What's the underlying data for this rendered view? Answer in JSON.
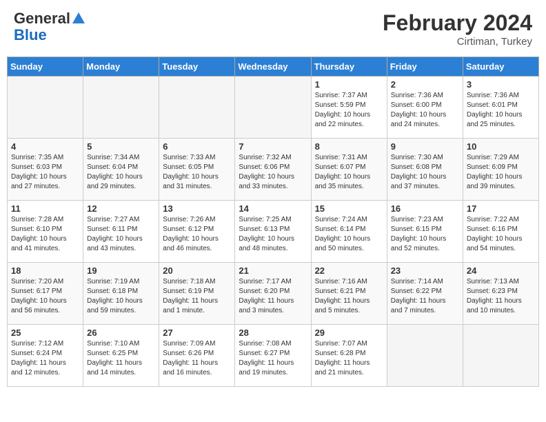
{
  "header": {
    "logo_general": "General",
    "logo_blue": "Blue",
    "month_title": "February 2024",
    "subtitle": "Cirtiman, Turkey"
  },
  "days_of_week": [
    "Sunday",
    "Monday",
    "Tuesday",
    "Wednesday",
    "Thursday",
    "Friday",
    "Saturday"
  ],
  "weeks": [
    [
      {
        "num": "",
        "info": ""
      },
      {
        "num": "",
        "info": ""
      },
      {
        "num": "",
        "info": ""
      },
      {
        "num": "",
        "info": ""
      },
      {
        "num": "1",
        "info": "Sunrise: 7:37 AM\nSunset: 5:59 PM\nDaylight: 10 hours and 22 minutes."
      },
      {
        "num": "2",
        "info": "Sunrise: 7:36 AM\nSunset: 6:00 PM\nDaylight: 10 hours and 24 minutes."
      },
      {
        "num": "3",
        "info": "Sunrise: 7:36 AM\nSunset: 6:01 PM\nDaylight: 10 hours and 25 minutes."
      }
    ],
    [
      {
        "num": "4",
        "info": "Sunrise: 7:35 AM\nSunset: 6:03 PM\nDaylight: 10 hours and 27 minutes."
      },
      {
        "num": "5",
        "info": "Sunrise: 7:34 AM\nSunset: 6:04 PM\nDaylight: 10 hours and 29 minutes."
      },
      {
        "num": "6",
        "info": "Sunrise: 7:33 AM\nSunset: 6:05 PM\nDaylight: 10 hours and 31 minutes."
      },
      {
        "num": "7",
        "info": "Sunrise: 7:32 AM\nSunset: 6:06 PM\nDaylight: 10 hours and 33 minutes."
      },
      {
        "num": "8",
        "info": "Sunrise: 7:31 AM\nSunset: 6:07 PM\nDaylight: 10 hours and 35 minutes."
      },
      {
        "num": "9",
        "info": "Sunrise: 7:30 AM\nSunset: 6:08 PM\nDaylight: 10 hours and 37 minutes."
      },
      {
        "num": "10",
        "info": "Sunrise: 7:29 AM\nSunset: 6:09 PM\nDaylight: 10 hours and 39 minutes."
      }
    ],
    [
      {
        "num": "11",
        "info": "Sunrise: 7:28 AM\nSunset: 6:10 PM\nDaylight: 10 hours and 41 minutes."
      },
      {
        "num": "12",
        "info": "Sunrise: 7:27 AM\nSunset: 6:11 PM\nDaylight: 10 hours and 43 minutes."
      },
      {
        "num": "13",
        "info": "Sunrise: 7:26 AM\nSunset: 6:12 PM\nDaylight: 10 hours and 46 minutes."
      },
      {
        "num": "14",
        "info": "Sunrise: 7:25 AM\nSunset: 6:13 PM\nDaylight: 10 hours and 48 minutes."
      },
      {
        "num": "15",
        "info": "Sunrise: 7:24 AM\nSunset: 6:14 PM\nDaylight: 10 hours and 50 minutes."
      },
      {
        "num": "16",
        "info": "Sunrise: 7:23 AM\nSunset: 6:15 PM\nDaylight: 10 hours and 52 minutes."
      },
      {
        "num": "17",
        "info": "Sunrise: 7:22 AM\nSunset: 6:16 PM\nDaylight: 10 hours and 54 minutes."
      }
    ],
    [
      {
        "num": "18",
        "info": "Sunrise: 7:20 AM\nSunset: 6:17 PM\nDaylight: 10 hours and 56 minutes."
      },
      {
        "num": "19",
        "info": "Sunrise: 7:19 AM\nSunset: 6:18 PM\nDaylight: 10 hours and 59 minutes."
      },
      {
        "num": "20",
        "info": "Sunrise: 7:18 AM\nSunset: 6:19 PM\nDaylight: 11 hours and 1 minute."
      },
      {
        "num": "21",
        "info": "Sunrise: 7:17 AM\nSunset: 6:20 PM\nDaylight: 11 hours and 3 minutes."
      },
      {
        "num": "22",
        "info": "Sunrise: 7:16 AM\nSunset: 6:21 PM\nDaylight: 11 hours and 5 minutes."
      },
      {
        "num": "23",
        "info": "Sunrise: 7:14 AM\nSunset: 6:22 PM\nDaylight: 11 hours and 7 minutes."
      },
      {
        "num": "24",
        "info": "Sunrise: 7:13 AM\nSunset: 6:23 PM\nDaylight: 11 hours and 10 minutes."
      }
    ],
    [
      {
        "num": "25",
        "info": "Sunrise: 7:12 AM\nSunset: 6:24 PM\nDaylight: 11 hours and 12 minutes."
      },
      {
        "num": "26",
        "info": "Sunrise: 7:10 AM\nSunset: 6:25 PM\nDaylight: 11 hours and 14 minutes."
      },
      {
        "num": "27",
        "info": "Sunrise: 7:09 AM\nSunset: 6:26 PM\nDaylight: 11 hours and 16 minutes."
      },
      {
        "num": "28",
        "info": "Sunrise: 7:08 AM\nSunset: 6:27 PM\nDaylight: 11 hours and 19 minutes."
      },
      {
        "num": "29",
        "info": "Sunrise: 7:07 AM\nSunset: 6:28 PM\nDaylight: 11 hours and 21 minutes."
      },
      {
        "num": "",
        "info": ""
      },
      {
        "num": "",
        "info": ""
      }
    ]
  ]
}
